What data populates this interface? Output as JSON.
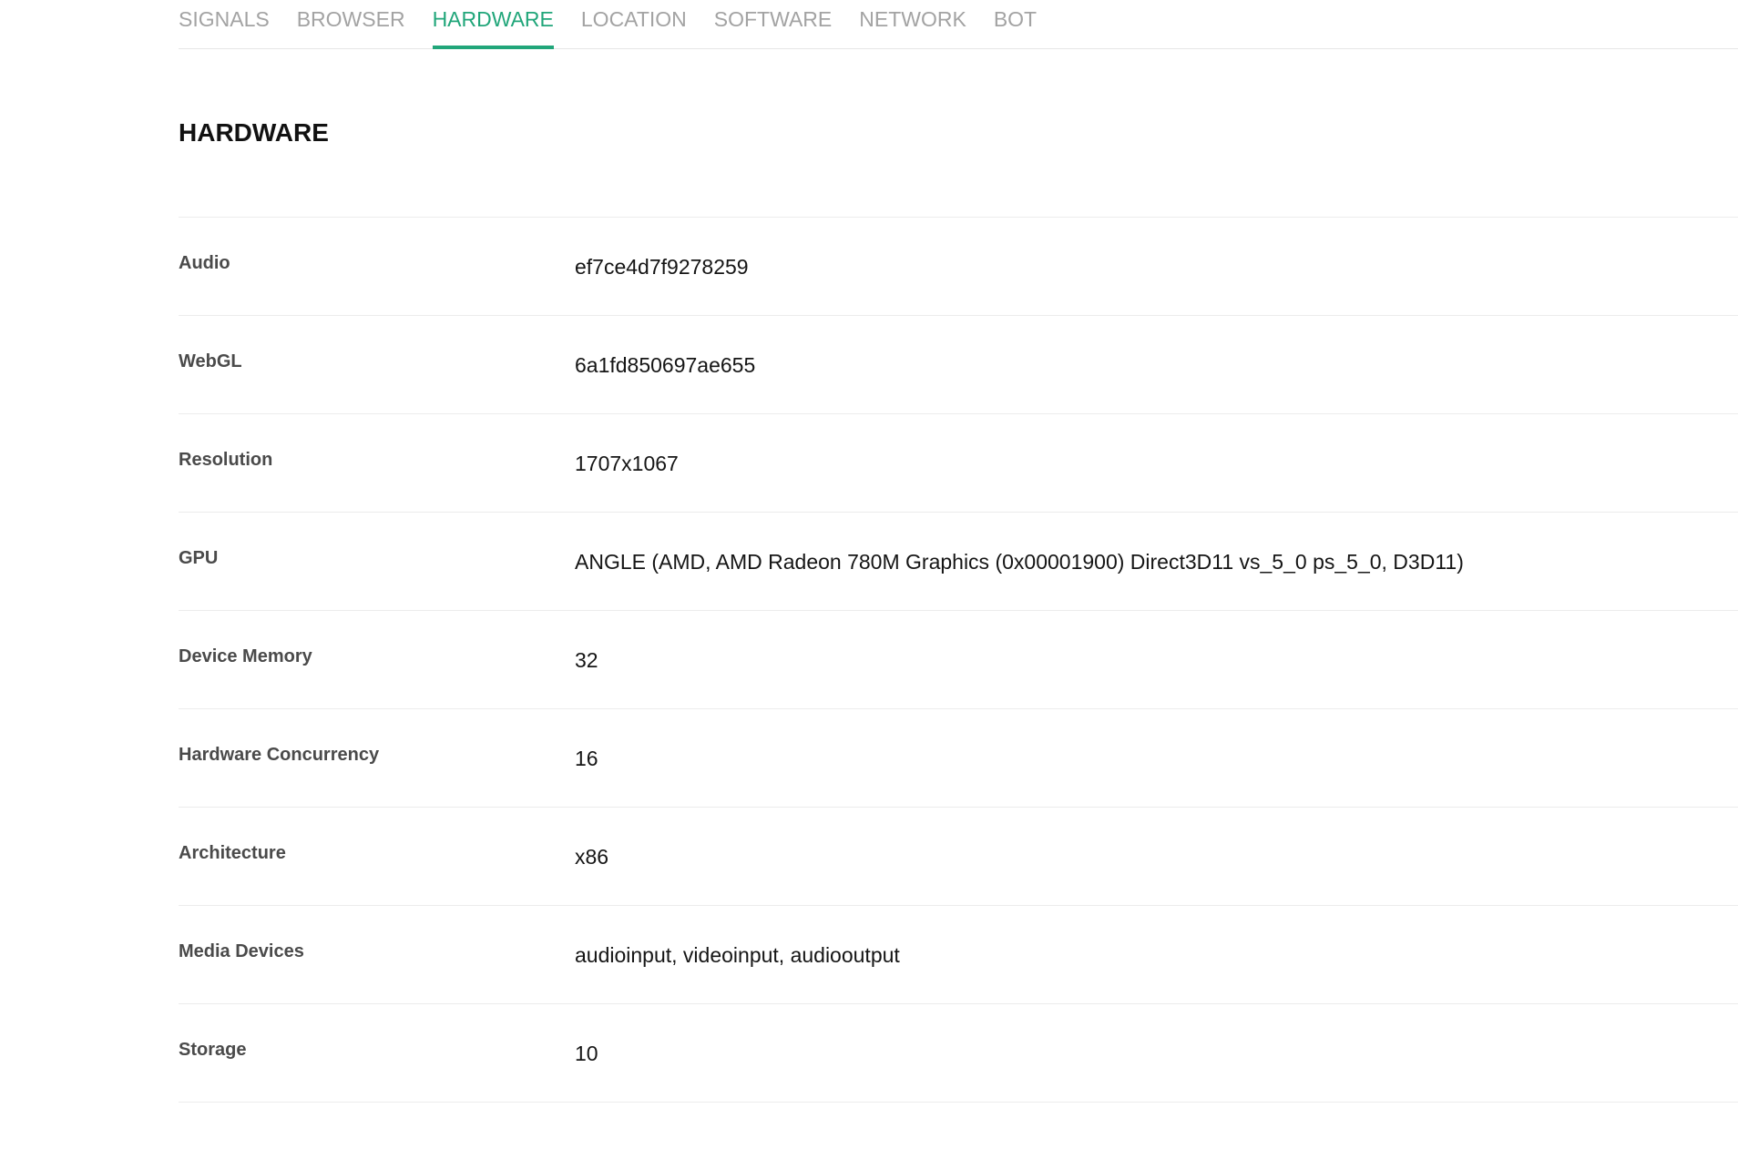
{
  "tabs": [
    {
      "label": "SIGNALS",
      "active": false
    },
    {
      "label": "BROWSER",
      "active": false
    },
    {
      "label": "HARDWARE",
      "active": true
    },
    {
      "label": "LOCATION",
      "active": false
    },
    {
      "label": "SOFTWARE",
      "active": false
    },
    {
      "label": "NETWORK",
      "active": false
    },
    {
      "label": "BOT",
      "active": false
    }
  ],
  "section": {
    "title": "HARDWARE"
  },
  "rows": [
    {
      "label": "Audio",
      "value": "ef7ce4d7f9278259"
    },
    {
      "label": "WebGL",
      "value": "6a1fd850697ae655"
    },
    {
      "label": "Resolution",
      "value": "1707x1067"
    },
    {
      "label": "GPU",
      "value": "ANGLE (AMD, AMD Radeon 780M Graphics (0x00001900) Direct3D11 vs_5_0 ps_5_0, D3D11)"
    },
    {
      "label": "Device Memory",
      "value": "32"
    },
    {
      "label": "Hardware Concurrency",
      "value": "16"
    },
    {
      "label": "Architecture",
      "value": "x86"
    },
    {
      "label": "Media Devices",
      "value": "audioinput, videoinput, audiooutput"
    },
    {
      "label": "Storage",
      "value": "10"
    }
  ],
  "colors": {
    "accent": "#21a67a",
    "tab_inactive": "#a3a3a3",
    "divider": "#ececec"
  }
}
